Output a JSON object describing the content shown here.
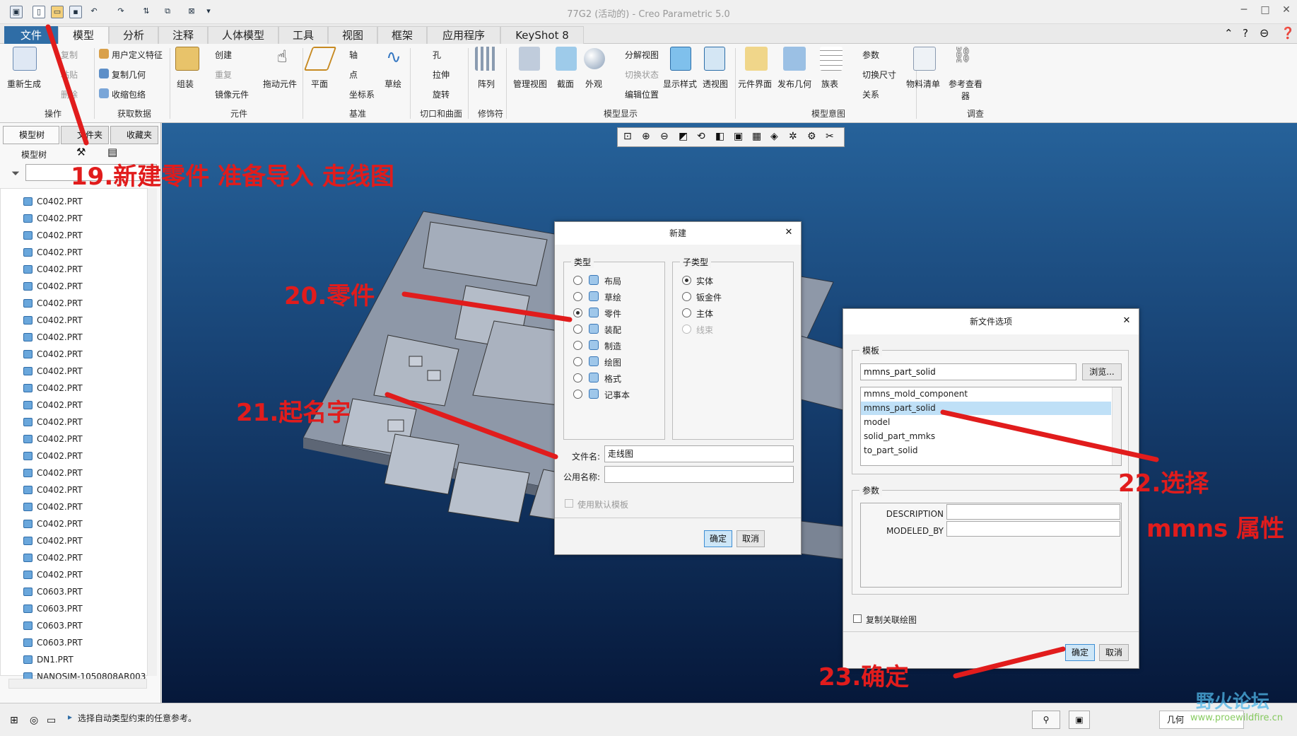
{
  "title_bar": {
    "window_title": "77G2 (活动的) - Creo Parametric 5.0"
  },
  "tabs": [
    "文件",
    "模型",
    "分析",
    "注释",
    "人体模型",
    "工具",
    "视图",
    "框架",
    "应用程序",
    "KeyShot 8"
  ],
  "ribbon": {
    "operations": {
      "regenerate": "重新生成",
      "copy": "复制",
      "paste": "粘贴",
      "delete": "删除",
      "group": "操作"
    },
    "get_data": {
      "udf": "用户定义特征",
      "copy_geom": "复制几何",
      "shrinkwrap": "收缩包络",
      "group": "获取数据"
    },
    "component": {
      "assemble": "组装",
      "create": "创建",
      "repeat": "重复",
      "mirror": "镜像元件",
      "drag": "拖动元件",
      "group": "元件"
    },
    "datum": {
      "plane": "平面",
      "axis": "轴",
      "point": "点",
      "csys": "坐标系",
      "sketch": "草绘",
      "group": "基准"
    },
    "cut_surface": {
      "hole": "孔",
      "extrude": "拉伸",
      "revolve": "旋转",
      "group": "切口和曲面"
    },
    "modifiers": {
      "pattern": "阵列",
      "group": "修饰符"
    },
    "model_display": {
      "manage_views": "管理视图",
      "section": "截面",
      "appearance": "外观",
      "explode": "分解视图",
      "toggle_state": "切换状态",
      "edit_position": "编辑位置",
      "display_style": "显示样式",
      "perspective": "透视图",
      "group": "模型显示"
    },
    "model_intent": {
      "component_interface": "元件界面",
      "publish_geom": "发布几何",
      "family_table": "族表",
      "parameters": "参数",
      "switch_dims": "切换尺寸",
      "relations": "关系",
      "group": "模型意图"
    },
    "investigate": {
      "bom": "物料清单",
      "ref_viewer": "参考查看器",
      "group": "调查"
    }
  },
  "left_panel": {
    "tabs": [
      "模型树",
      "文件夹",
      "收藏夹"
    ],
    "tree_label": "模型树",
    "items": [
      "C0402.PRT",
      "C0402.PRT",
      "C0402.PRT",
      "C0402.PRT",
      "C0402.PRT",
      "C0402.PRT",
      "C0402.PRT",
      "C0402.PRT",
      "C0402.PRT",
      "C0402.PRT",
      "C0402.PRT",
      "C0402.PRT",
      "C0402.PRT",
      "C0402.PRT",
      "C0402.PRT",
      "C0402.PRT",
      "C0402.PRT",
      "C0402.PRT",
      "C0402.PRT",
      "C0402.PRT",
      "C0402.PRT",
      "C0402.PRT",
      "C0402.PRT",
      "C0603.PRT",
      "C0603.PRT",
      "C0603.PRT",
      "C0603.PRT",
      "DN1.PRT",
      "NANOSIM-1050808AR003"
    ]
  },
  "dialog_new": {
    "title": "新建",
    "type_label": "类型",
    "types": [
      "布局",
      "草绘",
      "零件",
      "装配",
      "制造",
      "绘图",
      "格式",
      "记事本"
    ],
    "subtype_label": "子类型",
    "subtypes": [
      "实体",
      "钣金件",
      "主体",
      "线束"
    ],
    "filename_label": "文件名:",
    "filename_value": "走线图",
    "common_name_label": "公用名称:",
    "common_name_value": "",
    "use_default_template": "使用默认模板",
    "ok": "确定",
    "cancel": "取消"
  },
  "dialog_options": {
    "title": "新文件选项",
    "template_label": "模板",
    "template_value": "mmns_part_solid",
    "browse": "浏览...",
    "templates": [
      "mmns_mold_component",
      "mmns_part_solid",
      "model",
      "solid_part_mmks",
      "to_part_solid"
    ],
    "params_label": "参数",
    "params": [
      "DESCRIPTION",
      "MODELED_BY"
    ],
    "copy_drawings": "复制关联绘图",
    "ok": "确定",
    "cancel": "取消"
  },
  "status": {
    "message": "选择自动类型约束的任意参考。",
    "filter": "几何"
  },
  "annotations": {
    "a19": "19.新建零件  准备导入 走线图",
    "a20": "20.零件",
    "a21": "21.起名字",
    "a22": "22.选择",
    "a22b": "mmns 属性",
    "a23": "23.确定"
  },
  "watermark": {
    "name": "野火论坛",
    "url": "www.proewildfire.cn"
  },
  "colors": {
    "accent": "#e11c1c",
    "file_tab": "#2f6da6",
    "selected_row": "#bfe0f7"
  }
}
